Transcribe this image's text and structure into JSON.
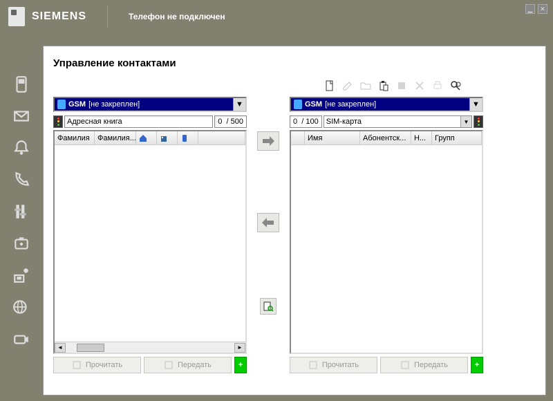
{
  "titlebar": {
    "brand": "SIEMENS",
    "status": "Телефон не подключен"
  },
  "page": {
    "title": "Управление контактами"
  },
  "left_pane": {
    "gsm_label": "GSM",
    "gsm_status": "[не закреплен]",
    "filter_value": "Адресная книга",
    "count_current": "0",
    "count_sep": "/",
    "count_max": "500",
    "columns": {
      "c1": "Фамилия",
      "c2": "Фамилия..."
    },
    "read_btn": "Прочитать",
    "transfer_btn": "Передать"
  },
  "right_pane": {
    "gsm_label": "GSM",
    "gsm_status": "[не закреплен]",
    "sim_value": "SIM-карта",
    "count_current": "0",
    "count_sep": "/",
    "count_max": "100",
    "columns": {
      "c1": "Имя",
      "c2": "Абонентск...",
      "c3": "Н...",
      "c4": "Групп"
    },
    "read_btn": "Прочитать",
    "transfer_btn": "Передать"
  }
}
